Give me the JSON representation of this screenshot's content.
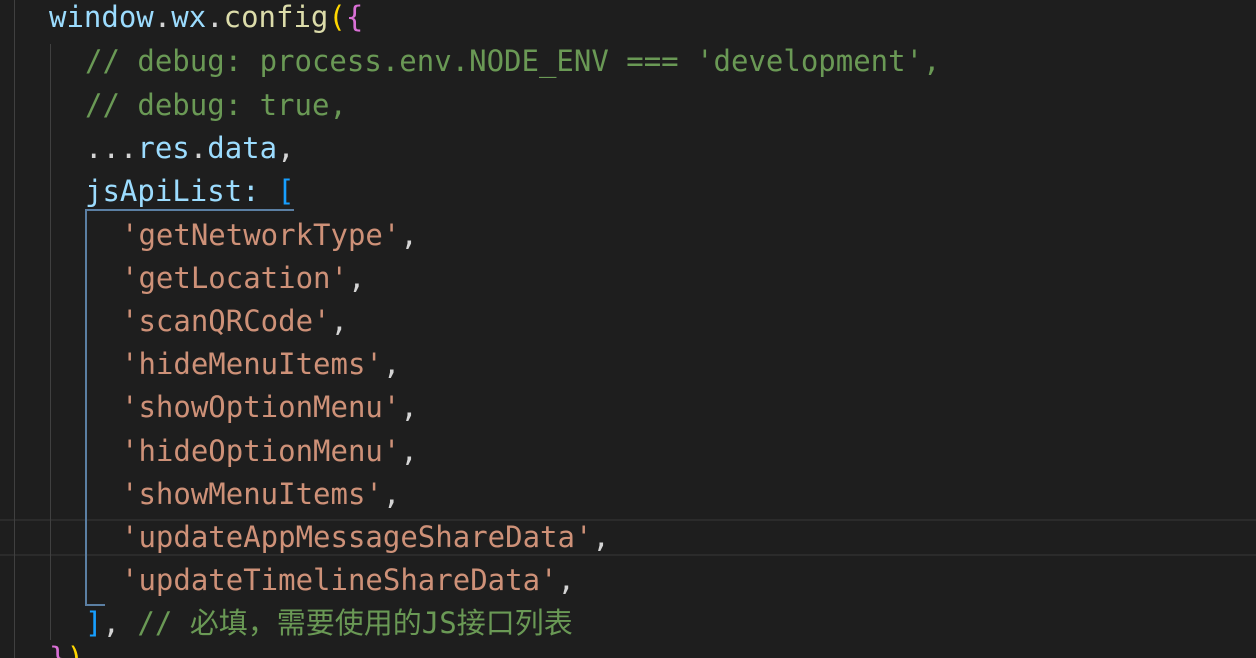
{
  "code": {
    "line1": {
      "window": "window",
      "dot1": ".",
      "wx": "wx",
      "dot2": ".",
      "config": "config",
      "paren": "(",
      "brace": "{"
    },
    "line2": {
      "comment": "// debug: process.env.NODE_ENV === 'development',"
    },
    "line3": {
      "comment": "// debug: true,"
    },
    "line4": {
      "spread": "...",
      "res": "res",
      "dot": ".",
      "data": "data",
      "comma": ","
    },
    "line5": {
      "key": "jsApiList",
      "colon": ": ",
      "bracket": "["
    },
    "api_list": [
      {
        "value": "'getNetworkType'",
        "comma": ","
      },
      {
        "value": "'getLocation'",
        "comma": ","
      },
      {
        "value": "'scanQRCode'",
        "comma": ","
      },
      {
        "value": "'hideMenuItems'",
        "comma": ","
      },
      {
        "value": "'showOptionMenu'",
        "comma": ","
      },
      {
        "value": "'hideOptionMenu'",
        "comma": ","
      },
      {
        "value": "'showMenuItems'",
        "comma": ","
      },
      {
        "value": "'updateAppMessageShareData'",
        "comma": ","
      },
      {
        "value": "'updateTimelineShareData'",
        "comma": ","
      }
    ],
    "closing": {
      "bracket": "]",
      "comma": ", ",
      "comment": "// 必填，需要使用的JS接口列表"
    },
    "partial_last": {
      "brace": "}",
      "paren": ")"
    }
  }
}
